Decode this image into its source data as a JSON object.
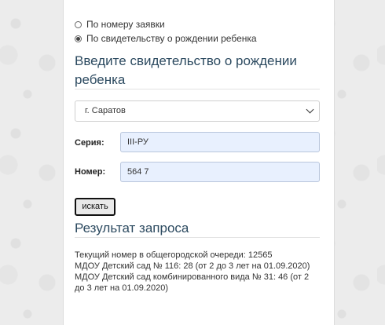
{
  "search_mode": {
    "options": [
      {
        "label": "По номеру заявки",
        "checked": false
      },
      {
        "label": "По свидетельству о рождении ребенка",
        "checked": true
      }
    ]
  },
  "form": {
    "title_line1": "Введите свидетельство о рождении",
    "title_line2": "ребенка",
    "city_select": "г. Саратов",
    "series_label": "Серия:",
    "series_value": "III-РУ",
    "number_label": "Номер:",
    "number_value": "564 7",
    "search_button": "искать"
  },
  "result": {
    "title": "Результат запроса",
    "lines": [
      "Текущий номер в общегородской очереди: 12565",
      "МДОУ Детский сад № 116: 28 (от 2 до 3 лет на 01.09.2020)",
      "МДОУ Детский сад комбинированного вида № 31: 46 (от 2",
      "до 3 лет на 01.09.2020)"
    ]
  }
}
